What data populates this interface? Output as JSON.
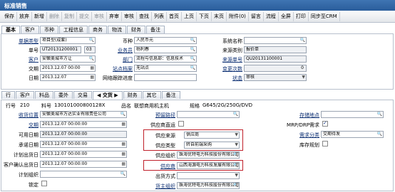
{
  "title": "标准销售",
  "toolbar": [
    "保存",
    "放弃",
    "新增",
    "删除",
    "复制",
    "提交",
    "审核",
    "弃审",
    "审核",
    "查找",
    "列表",
    "首页",
    "上页",
    "下页",
    "末页",
    "附件(0)",
    "留言",
    "流程",
    "全屏",
    "打印",
    "同步至CRM"
  ],
  "toolbar_disabled": [
    3,
    4,
    5,
    6
  ],
  "tabs": [
    "基本",
    "客户",
    "币种",
    "工程信息",
    "商务",
    "物流",
    "财务",
    "备注"
  ],
  "header": {
    "doc_type_label": "单据类型",
    "doc_type_value": "项目型(成套)",
    "number_label": "单号",
    "number_value": "UT20131200001",
    "number_seq": "03",
    "customer_label": "客户",
    "customer_value": "安徽美城市方让",
    "date_label": "交期",
    "date_value": "2013.12.07 00:00",
    "day_label": "日期",
    "day_value": "2013.12.07",
    "currency_label": "币种",
    "currency_value": "人民币元",
    "salesman_label": "业务员",
    "salesman_value": "杨利春",
    "dept_label": "部门",
    "dept_value": "流程与信息部：信息技术",
    "station_label": "站点档案",
    "station_value": "无站点",
    "track_label": "网络跟踪进度",
    "track_value": "",
    "system_label": "系统名称",
    "system_value": "",
    "source_type_label": "来源类别",
    "source_type_value": "报价单",
    "source_no_label": "来源单号",
    "source_no_value": "QU20131100001",
    "change_label": "变更次数",
    "change_value": "0",
    "status_label": "状态",
    "status_value": "审核"
  },
  "subtabs": [
    "行",
    "客户",
    "料品",
    "委外",
    "交易",
    "◀ 交货 ▶",
    "财务",
    "其它",
    "备注"
  ],
  "line": {
    "row_label": "行号",
    "row_value": "210",
    "item_label": "料号",
    "item_value": "130101000800128X",
    "name_label": "品名",
    "name_value": "联想商用机主机",
    "spec_label": "规格",
    "spec_value": "G645/2G/250G/DVD"
  },
  "detail": {
    "receiver_label": "收货位置",
    "receiver_value": "安徽美城市万达实业有限责任公司",
    "delivery_label": "交期",
    "delivery_value": "2013.12.07 00:00:00",
    "avail_label": "可用日期",
    "avail_value": "2013.12.07 00:00:00",
    "promise_label": "承诺日期",
    "promise_value": "2013.12.07 00:00:00",
    "plan_label": "计划出货日",
    "plan_value": "2013.12.07 00:00:00",
    "cust_date_label": "客户确认出货日",
    "cust_date_value": "2013.12.07 00:00:00",
    "plan_org_label": "计划组织",
    "plan_org_value": "",
    "lock_label": "锁定",
    "trace_label": "预留路径",
    "trace_value": "",
    "supplier_query_label": "供应商直运",
    "supply_source_label": "供应来源",
    "supply_source_value": "供应商",
    "supply_type_label": "供应类型",
    "supply_type_value": "转自前端采购",
    "supply_org_label": "供应组织",
    "supply_org_value": "珠海优特电力科技股份有限公司",
    "supplier_label": "供应商",
    "supplier_value": "山西海源电力科技发展有限公司",
    "ship_method_label": "出货方式",
    "ship_method_value": "",
    "cargo_org_label": "货主组织",
    "cargo_org_value": "珠海优特电力科技股份有限公司",
    "storage_label": "存储地点",
    "storage_value": "",
    "mrp_label": "MRP/DRP需求",
    "demand_label": "需求分类",
    "demand_value": "交期待发",
    "stock_label": "库存规划"
  }
}
